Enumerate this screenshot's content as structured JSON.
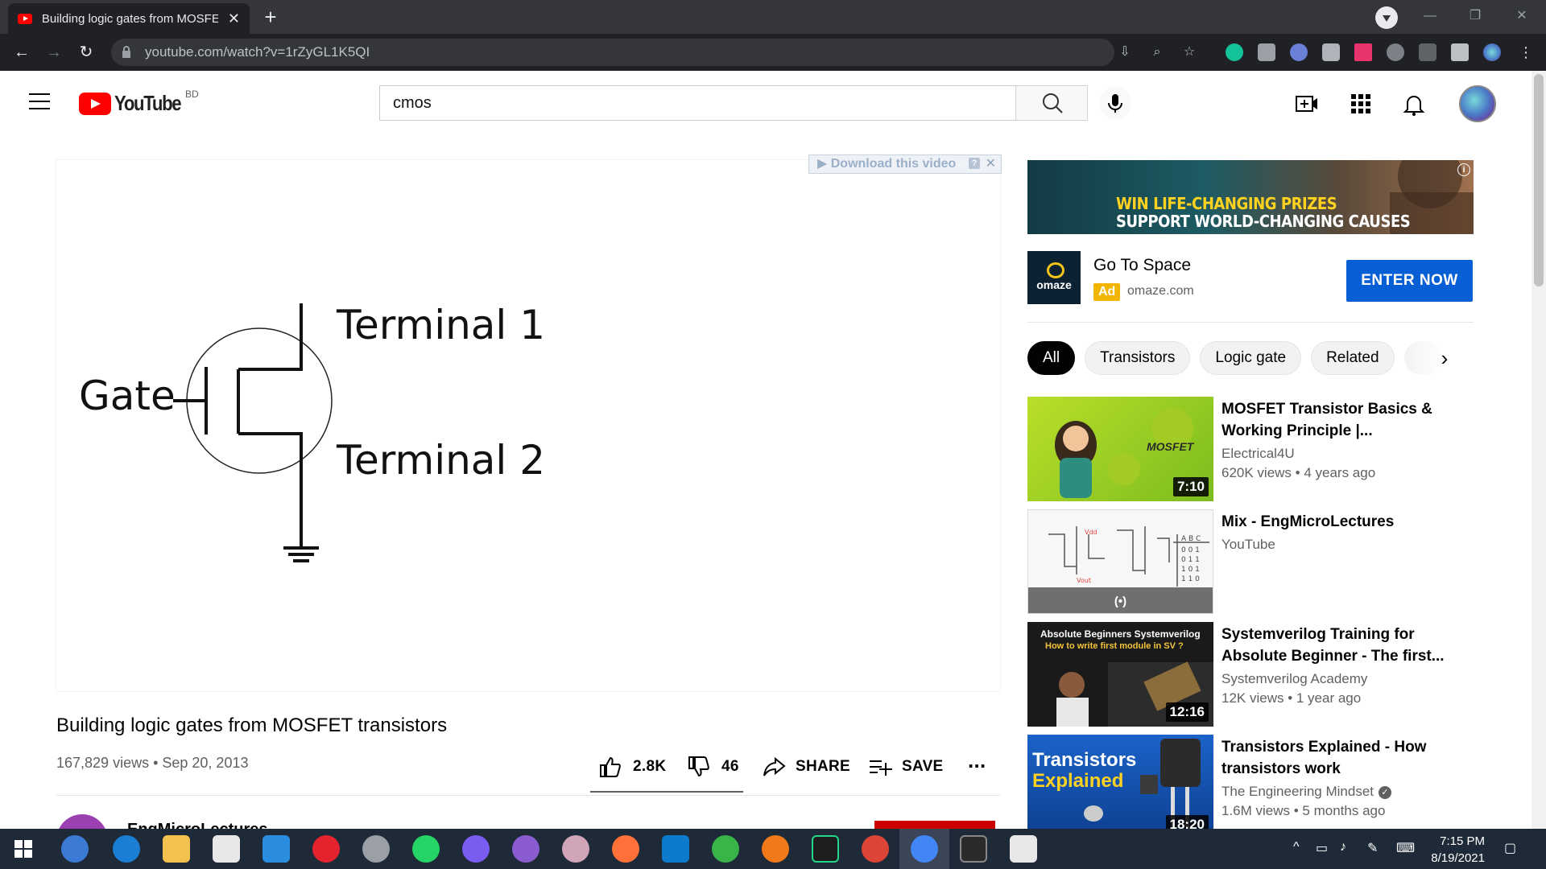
{
  "browser": {
    "tab_title": "Building logic gates from MOSFE",
    "tab_close": "✕",
    "new_tab": "+",
    "url": "youtube.com/watch?v=1rZyGL1K5QI"
  },
  "masthead": {
    "logo_text": "YouTube",
    "country_code": "BD",
    "search_value": "cmos"
  },
  "player": {
    "download_label": "Download this video",
    "download_help": "?",
    "download_close": "✕",
    "diagram": {
      "gate_label": "Gate",
      "terminal1_label": "Terminal 1",
      "terminal2_label": "Terminal 2"
    }
  },
  "video": {
    "title": "Building logic gates from MOSFET transistors",
    "views_date": "167,829 views • Sep 20, 2013",
    "likes": "2.8K",
    "dislikes": "46",
    "share_label": "SHARE",
    "save_label": "SAVE",
    "more_label": "...",
    "channel_name": "EngMicroLectures"
  },
  "ad": {
    "banner_line1": "WIN LIFE-CHANGING PRIZES",
    "banner_line2": "SUPPORT WORLD-CHANGING CAUSES",
    "info": "i",
    "logo_text": "omaze",
    "title": "Go To Space",
    "badge": "Ad",
    "domain": "omaze.com",
    "cta": "ENTER NOW"
  },
  "chips": [
    "All",
    "Transistors",
    "Logic gate",
    "Related"
  ],
  "recommendations": [
    {
      "title": "MOSFET Transistor Basics & Working Principle |...",
      "channel": "Electrical4U",
      "meta": "620K views • 4 years ago",
      "duration": "7:10",
      "thumb_text": "MOSFET"
    },
    {
      "title": "Mix - EngMicroLectures",
      "channel": "YouTube",
      "meta": "",
      "duration": "(•)",
      "thumb_text": ""
    },
    {
      "title": "Systemverilog Training for Absolute Beginner - The first...",
      "channel": "Systemverilog Academy",
      "meta": "12K views • 1 year ago",
      "duration": "12:16",
      "thumb_text": "Absolute Beginners Systemverilog",
      "thumb_sub": "How to write first module in SV ?"
    },
    {
      "title": "Transistors Explained - How transistors work",
      "channel": "The Engineering Mindset",
      "meta": "1.6M views • 5 months ago",
      "duration": "18:20",
      "thumb_text": "Transistors",
      "thumb_sub": "Explained",
      "verified": true
    }
  ],
  "taskbar": {
    "time": "7:15 PM",
    "date": "8/19/2021"
  },
  "colors": {
    "youtube_red": "#ff0000",
    "cta_blue": "#065fd4",
    "ad_yellow": "#f2b600",
    "chrome_dark": "#202124",
    "taskbar": "#1f2a38"
  }
}
